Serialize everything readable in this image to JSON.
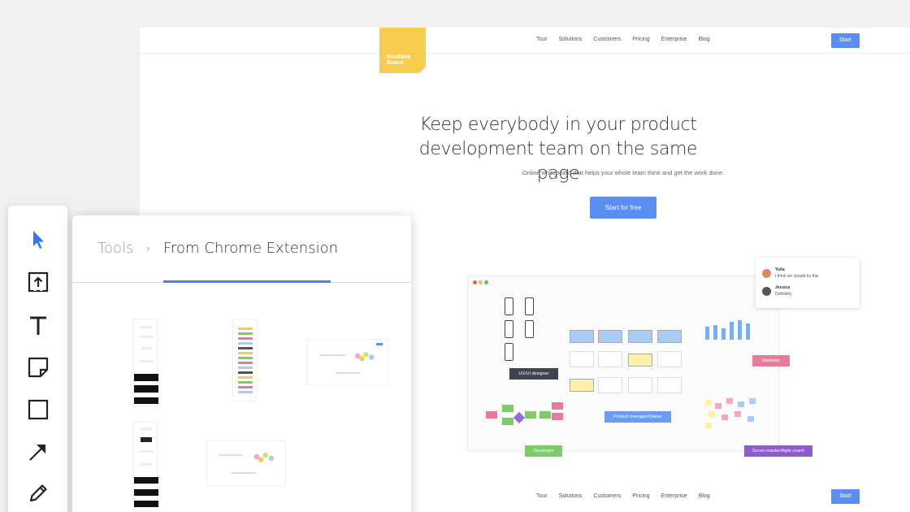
{
  "site": {
    "logo_text": "Realtime Board",
    "nav": [
      "Tour",
      "Solutions",
      "Customers",
      "Pricing",
      "Enterprise",
      "Blog"
    ],
    "start_button": "Start",
    "hero_title": "Keep everybody in your product development team on the same page",
    "hero_subtitle": "Online whiteboard that helps your whole team think and get the work done.",
    "cta_button": "Start for free",
    "board_labels": {
      "ux_designer": "UX/UI designer",
      "marketer": "Marketer",
      "product_manager": "Product manager/Owner",
      "developer": "Developer",
      "scrum_master": "Scrum master/Agile coach"
    },
    "chat": [
      {
        "name": "Yulia",
        "text": "I think we should try this"
      },
      {
        "name": "Jessica",
        "text": "Definitely"
      }
    ]
  },
  "panel": {
    "crumb_root": "Tools",
    "crumb_separator": "›",
    "crumb_current": "From Chrome Extension"
  },
  "toolbar": {
    "tools": [
      "select-icon",
      "upload-icon",
      "text-icon",
      "sticky-note-icon",
      "rectangle-icon",
      "arrow-icon",
      "pen-icon"
    ]
  },
  "colors": {
    "accent": "#5b8ef5",
    "logo": "#f8cd4f",
    "tab_indicator": "#4a7ff0"
  }
}
